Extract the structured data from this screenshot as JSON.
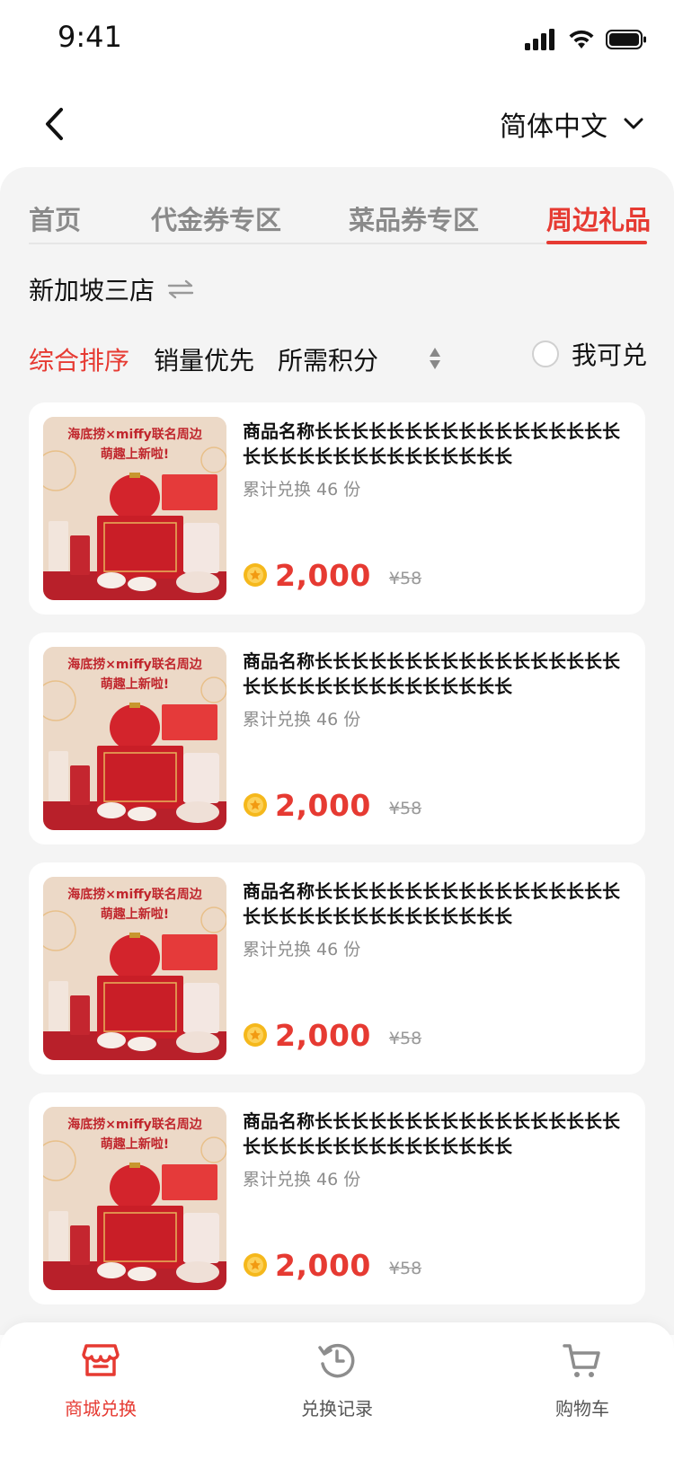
{
  "status_bar": {
    "time": "9:41"
  },
  "nav": {
    "language": "简体中文"
  },
  "tabs": [
    {
      "label": "首页"
    },
    {
      "label": "代金券专区"
    },
    {
      "label": "菜品券专区"
    },
    {
      "label": "周边礼品",
      "active": true
    }
  ],
  "store": {
    "name": "新加坡三店"
  },
  "filters": {
    "sort_default": "综合排序",
    "sort_sales": "销量优先",
    "sort_points": "所需积分",
    "redeemable_label": "我可兑"
  },
  "products": [
    {
      "banner_line1": "海底捞×miffy联名周边",
      "banner_line2": "萌趣上新啦!",
      "title": "商品名称长长长长长长长长长长长长长长长长长长长长长长长长长长长长长长长长",
      "sold": "累计兑换 46 份",
      "points": "2,000",
      "original_price": "¥58"
    },
    {
      "banner_line1": "海底捞×miffy联名周边",
      "banner_line2": "萌趣上新啦!",
      "title": "商品名称长长长长长长长长长长长长长长长长长长长长长长长长长长长长长长长长",
      "sold": "累计兑换 46 份",
      "points": "2,000",
      "original_price": "¥58"
    },
    {
      "banner_line1": "海底捞×miffy联名周边",
      "banner_line2": "萌趣上新啦!",
      "title": "商品名称长长长长长长长长长长长长长长长长长长长长长长长长长长长长长长长长",
      "sold": "累计兑换 46 份",
      "points": "2,000",
      "original_price": "¥58"
    },
    {
      "banner_line1": "海底捞×miffy联名周边",
      "banner_line2": "萌趣上新啦!",
      "title": "商品名称长长长长长长长长长长长长长长长长长长长长长长长长长长长长长长长长",
      "sold": "累计兑换 46 份",
      "points": "2,000",
      "original_price": "¥58"
    }
  ],
  "tabbar": {
    "shop": "商城兑换",
    "history": "兑换记录",
    "cart": "购物车"
  },
  "colors": {
    "accent": "#e63a32",
    "background": "#f4f4f4",
    "coin": "#f5b81c"
  }
}
